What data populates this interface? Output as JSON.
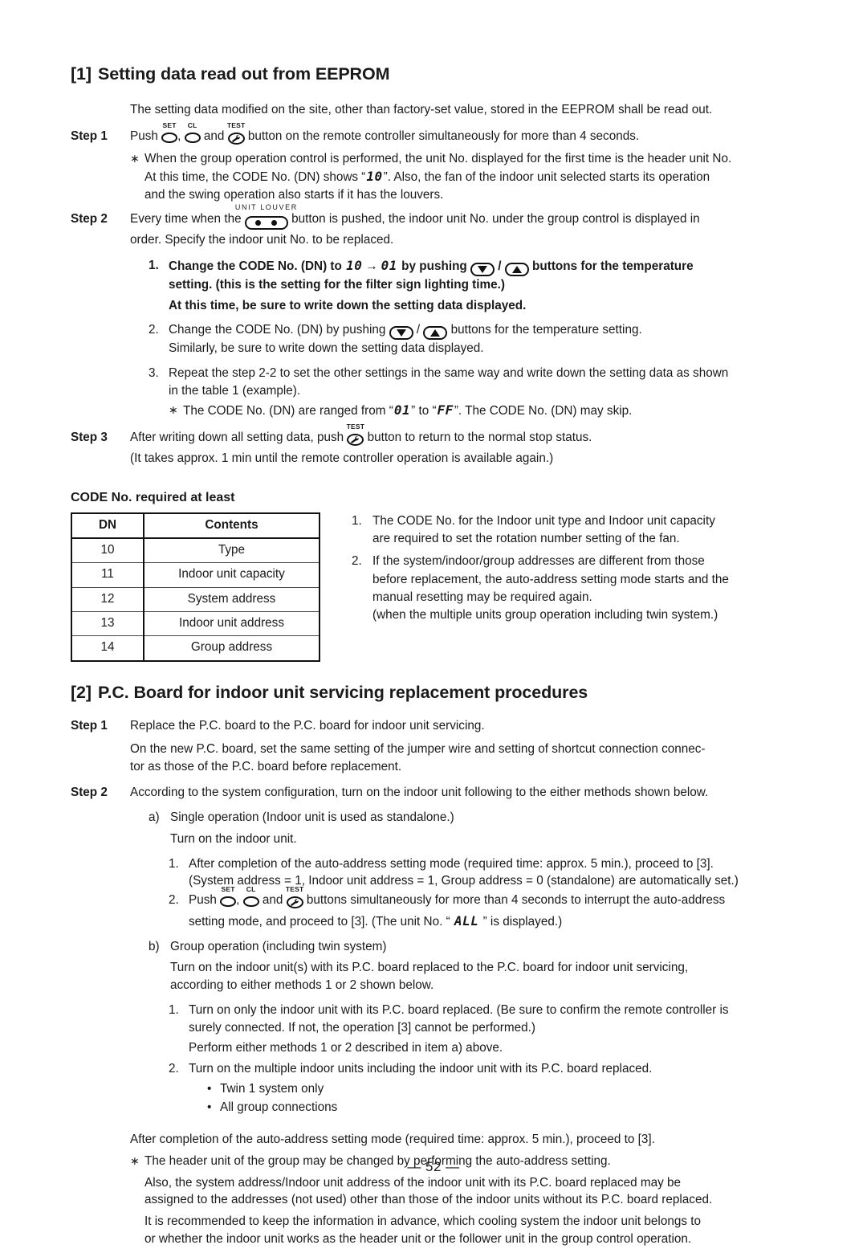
{
  "page": {
    "page_number": "— 52 —"
  },
  "section1": {
    "number": "[1]",
    "title": "Setting data read out from EEPROM",
    "intro": "The setting data modified on the site, other than factory-set value, stored in the EEPROM shall be read out.",
    "step1": {
      "label": "Step 1",
      "text_a": "Push ",
      "text_b": ", ",
      "text_c": " and ",
      "text_d": " button on the remote controller simultaneously for more than 4 seconds.",
      "note_mark": "∗",
      "note_line1": "When the group operation control is performed, the unit No. displayed for the first time is the header unit No.",
      "note_line2_a": "At this time, the CODE No. (DN) shows “",
      "note_line2_lcd": "10",
      "note_line2_b": "”. Also, the fan of the indoor unit selected starts its operation",
      "note_line3": "and the swing operation also starts if it has the louvers."
    },
    "step2": {
      "label": "Step 2",
      "text_a": "Every time when the ",
      "text_b": " button is pushed, the indoor unit No. under the group control is displayed in",
      "text_c": "order. Specify the indoor unit No. to be replaced.",
      "item1": {
        "mark": "1.",
        "a": "Change the CODE No. (DN) to ",
        "lcd_from": "10",
        "arrow": "→",
        "lcd_to": "01",
        "b": " by pushing ",
        "c": " / ",
        "d": " buttons for the temperature",
        "line2": "setting. (this is the setting for the filter sign lighting time.)",
        "line3": "At this time, be sure to write down the setting data displayed."
      },
      "item2": {
        "mark": "2.",
        "a": "Change the CODE No. (DN) by pushing ",
        "b": " / ",
        "c": " buttons for the temperature setting.",
        "line2": "Similarly, be sure to write down the setting data displayed."
      },
      "item3": {
        "mark": "3.",
        "line1": "Repeat the step 2-2 to set the other settings in the same way and write down the setting data as shown",
        "line2": "in the table 1 (example).",
        "note_mark": "∗",
        "note_a": "The CODE No. (DN) are ranged from “",
        "note_lcd_from": "01",
        "note_b": "” to “",
        "note_lcd_to": "FF",
        "note_c": "”. The CODE No. (DN) may skip."
      }
    },
    "step3": {
      "label": "Step 3",
      "text_a": "After writing down all setting data, push ",
      "text_b": " button to return to the normal stop status.",
      "line2": "(It takes approx. 1 min until the remote controller operation is available again.)"
    },
    "table": {
      "title": "CODE No. required at least",
      "headers": [
        "DN",
        "Contents"
      ],
      "rows": [
        [
          "10",
          "Type"
        ],
        [
          "11",
          "Indoor unit capacity"
        ],
        [
          "12",
          "System address"
        ],
        [
          "13",
          "Indoor unit address"
        ],
        [
          "14",
          "Group address"
        ]
      ]
    },
    "side_notes": [
      {
        "mark": "1.",
        "lines": [
          "The CODE No. for the Indoor unit type and Indoor unit capacity",
          "are required to set the rotation number setting of the fan."
        ]
      },
      {
        "mark": "2.",
        "lines": [
          "If the system/indoor/group addresses are different from those",
          "before replacement, the auto-address setting mode starts and the",
          "manual resetting may be required again.",
          "(when the multiple units group operation including twin system.)"
        ]
      }
    ]
  },
  "section2": {
    "number": "[2]",
    "title": "P.C. Board for indoor unit servicing replacement procedures",
    "step1": {
      "label": "Step 1",
      "line1": "Replace the P.C. board to the P.C. board for indoor unit servicing.",
      "line2": "On the new P.C. board, set the same setting of the jumper wire and setting of shortcut connection connec-",
      "line3": "tor as those of the P.C. board before replacement."
    },
    "step2": {
      "label": "Step 2",
      "line1": "According to the system configuration, turn on the indoor unit following to the either methods shown below.",
      "item_a": {
        "mark": "a)",
        "title": "Single operation (Indoor unit is used as standalone.)",
        "line2": "Turn on the indoor unit.",
        "sub1": {
          "mark": "1.",
          "line1": "After completion of the auto-address setting mode (required time: approx. 5 min.), proceed to [3].",
          "line2": "(System address = 1, Indoor unit address = 1, Group address = 0 (standalone) are automatically set.)"
        },
        "sub2": {
          "mark": "2.",
          "a": "Push ",
          "b": ", ",
          "c": " and ",
          "d": " buttons simultaneously for more than 4 seconds to interrupt the auto-address",
          "line2_a": "setting mode, and proceed to [3]. (The unit No. “ ",
          "line2_lcd": "ALL",
          "line2_b": " ” is displayed.)"
        }
      },
      "item_b": {
        "mark": "b)",
        "title": "Group operation (including twin system)",
        "line2": "Turn on the indoor unit(s) with its P.C. board replaced to the P.C. board for indoor unit servicing,",
        "line3": "according to either methods 1 or 2 shown below.",
        "sub1": {
          "mark": "1.",
          "line1": "Turn on only the indoor unit with its P.C. board replaced. (Be sure to confirm the remote controller is",
          "line2": "surely connected. If not, the operation [3] cannot be performed.)",
          "line3": "Perform either methods 1 or 2 described in item a) above."
        },
        "sub2": {
          "mark": "2.",
          "line1": "Turn on the multiple indoor units including the indoor unit with its P.C. board replaced.",
          "bullets": [
            "Twin 1 system only",
            "All group connections"
          ]
        },
        "closing": "After completion of the auto-address setting mode (required time: approx. 5 min.), proceed to [3].",
        "final_note": {
          "mark": "∗",
          "line1": "The header unit of the group may be changed by performing the auto-address setting.",
          "line2": "Also, the system address/Indoor unit address of the indoor unit with its P.C. board replaced may be",
          "line3": "assigned to the addresses (not used) other than those of the indoor units without its P.C. board replaced.",
          "line4": "It is recommended to keep the information in advance, which cooling system the indoor unit belongs to",
          "line5": "or whether the indoor unit works as the header unit or the follower unit in the group control operation."
        }
      }
    }
  },
  "icons": {
    "set_caption": "SET",
    "cl_caption": "CL",
    "test_caption": "TEST",
    "unit_louver_caption": "UNIT LOUVER"
  },
  "colors": {
    "text": "#1a1a1a",
    "rule": "#111111",
    "table_inner_rule": "#444444",
    "background": "#ffffff"
  }
}
